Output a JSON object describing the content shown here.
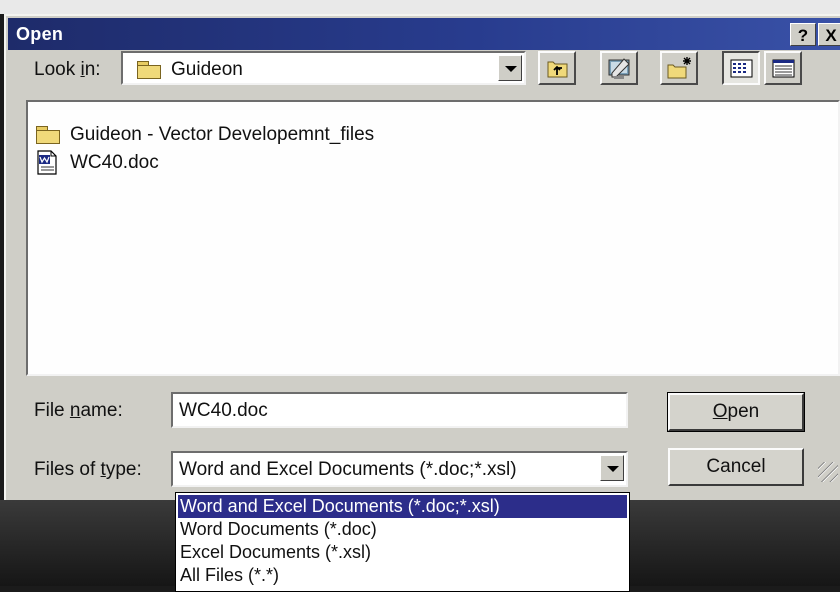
{
  "window": {
    "title": "Open",
    "help_glyph": "?",
    "close_glyph": "X"
  },
  "look_in": {
    "label_prefix": "Look ",
    "label_accel": "i",
    "label_suffix": "n:",
    "value": "Guideon",
    "icon": "folder-icon"
  },
  "toolbar": {
    "icons": [
      "up-one-level-icon",
      "desktop-icon",
      "new-folder-icon",
      "list-view-icon",
      "details-view-icon"
    ]
  },
  "files": [
    {
      "name": "Guideon - Vector Developemnt_files",
      "icon": "folder-icon"
    },
    {
      "name": "WC40.doc",
      "icon": "word-document-icon"
    }
  ],
  "file_name": {
    "label_prefix": "File ",
    "label_accel": "n",
    "label_suffix": "ame:",
    "value": "WC40.doc"
  },
  "files_of_type": {
    "label_prefix": "Files of ",
    "label_accel": "t",
    "label_suffix": "ype:",
    "value": "Word and Excel Documents (*.doc;*.xsl)",
    "options": [
      "Word and Excel Documents (*.doc;*.xsl)",
      "Word Documents (*.doc)",
      "Excel Documents (*.xsl)",
      "All Files (*.*)"
    ],
    "selected_index": 0
  },
  "buttons": {
    "open_accel": "O",
    "open_rest": "pen",
    "cancel": "Cancel"
  },
  "colors": {
    "titlebar": "#283c8e",
    "selection": "#2c2d8a",
    "face": "#cfcec7"
  }
}
